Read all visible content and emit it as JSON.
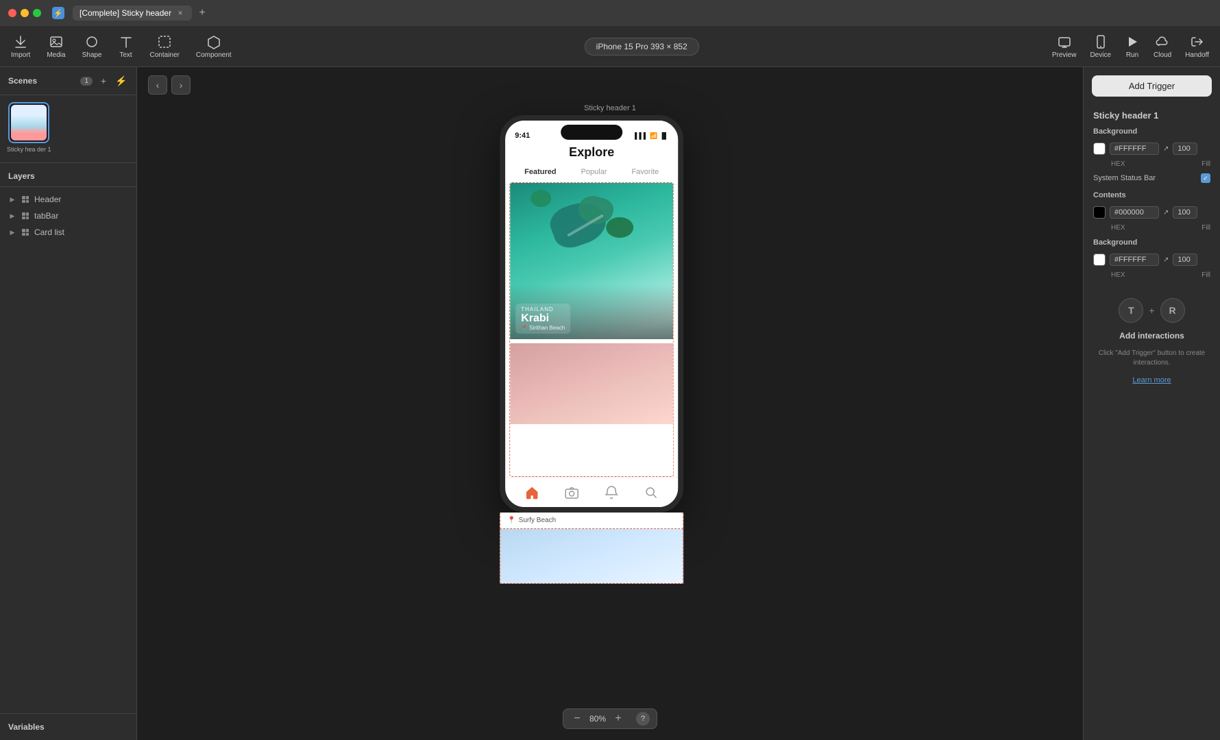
{
  "titleBar": {
    "tabTitle": "[Complete] Sticky header",
    "appIcon": "🏠"
  },
  "toolbar": {
    "import": "Import",
    "media": "Media",
    "shape": "Shape",
    "text": "Text",
    "container": "Container",
    "component": "Component",
    "devicePill": "iPhone 15 Pro  393 × 852",
    "preview": "Preview",
    "device": "Device",
    "run": "Run",
    "cloud": "Cloud",
    "handoff": "Handoff"
  },
  "scenes": {
    "title": "Scenes",
    "count": "1",
    "items": [
      {
        "label": "Sticky hea der 1"
      }
    ]
  },
  "layers": {
    "title": "Layers",
    "items": [
      {
        "name": "Header"
      },
      {
        "name": "tabBar"
      },
      {
        "name": "Card list"
      }
    ]
  },
  "variables": {
    "title": "Variables"
  },
  "canvas": {
    "sceneLabel": "Sticky header 1",
    "zoom": "80%"
  },
  "phone": {
    "statusTime": "9:41",
    "appTitle": "Explore",
    "tabs": [
      "Featured",
      "Popular",
      "Favorite"
    ],
    "activeTab": "Featured",
    "card1": {
      "country": "THAILAND",
      "city": "Krabi",
      "location": "Sirithan Beach"
    },
    "card2": {
      "location": "Surfy Beach"
    },
    "navIcons": [
      "home",
      "camera",
      "bell",
      "search"
    ]
  },
  "rightPanel": {
    "addTriggerLabel": "Add Trigger",
    "panelTitle": "Sticky header 1",
    "background": {
      "label": "Background",
      "hex": "#FFFFFF",
      "opacity": "100",
      "hexLabel": "HEX",
      "fillLabel": "Fill"
    },
    "systemStatusBar": {
      "label": "System Status Bar"
    },
    "contents": {
      "label": "Contents",
      "hex": "#000000",
      "opacity": "100",
      "hexLabel": "HEX",
      "fillLabel": "Fill"
    },
    "contentsBackground": {
      "label": "Background",
      "hex": "#FFFFFF",
      "opacity": "100",
      "hexLabel": "HEX",
      "fillLabel": "Fill"
    },
    "interactions": {
      "title": "Add interactions",
      "desc": "Click \"Add Trigger\" button\nto create interactions.",
      "learnMore": "Learn more",
      "keyT": "T",
      "keyR": "R"
    }
  }
}
